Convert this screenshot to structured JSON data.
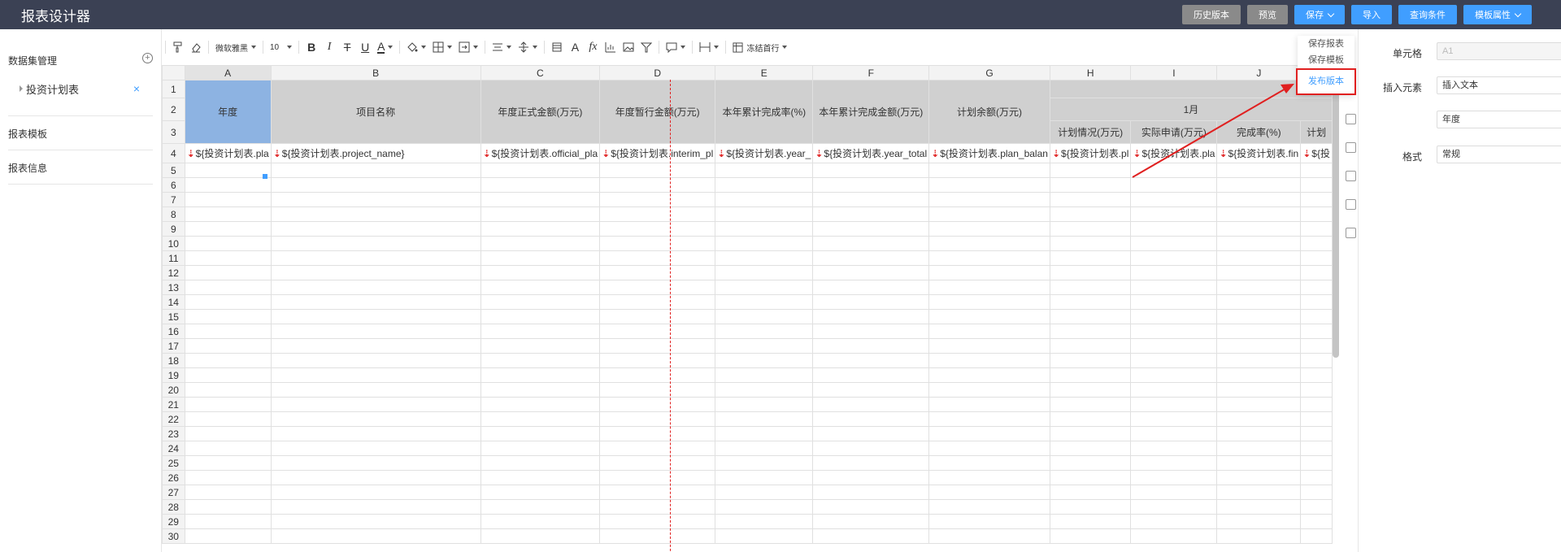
{
  "app": {
    "title": "报表设计器"
  },
  "top_buttons": {
    "history": "历史版本",
    "preview": "预览",
    "save": "保存",
    "import": "导入",
    "query": "查询条件",
    "template_props": "模板属性"
  },
  "save_menu": {
    "items": [
      "保存报表",
      "保存模板",
      "发布版本"
    ]
  },
  "sidebar": {
    "dataset": "数据集管理",
    "dataset_item": "投资计划表",
    "templates": "报表模板",
    "info": "报表信息"
  },
  "toolbar": {
    "font": "微软雅黑",
    "size": "10",
    "freeze": "冻结首行"
  },
  "columns": [
    "A",
    "B",
    "C",
    "D",
    "E",
    "F",
    "G",
    "H",
    "I",
    "J"
  ],
  "headers": {
    "A": "年度",
    "B": "项目名称",
    "C": "年度正式金额(万元)",
    "D": "年度暂行金额(万元)",
    "E": "本年累计完成率(%)",
    "F": "本年累计完成金额(万元)",
    "G": "计划余额(万元)",
    "month": "1月",
    "H": "计划情况(万元)",
    "I": "实际申请(万元)",
    "J": "完成率(%)",
    "K": "计划"
  },
  "fields": {
    "A": "${投资计划表.pla",
    "B": "${投资计划表.project_name}",
    "C": "${投资计划表.official_pla",
    "D": "${投资计划表.interim_pl",
    "E": "${投资计划表.year_",
    "F": "${投资计划表.year_total",
    "G": "${投资计划表.plan_balan",
    "H": "${投资计划表.pl",
    "I": "${投资计划表.pla",
    "J": "${投资计划表.fin",
    "K": "${投"
  },
  "row_numbers": [
    "1",
    "2",
    "3",
    "4",
    "5",
    "6",
    "7",
    "8",
    "9",
    "10",
    "11",
    "12",
    "13",
    "14",
    "15",
    "16",
    "17",
    "18",
    "19",
    "20",
    "21",
    "22",
    "23",
    "24",
    "25",
    "26",
    "27",
    "28",
    "29",
    "30"
  ],
  "properties": {
    "cell_label": "单元格",
    "cell_value": "A1",
    "insert_label": "插入元素",
    "insert_value": "插入文本",
    "text_value": "年度",
    "format_label": "格式",
    "format_value": "常规"
  },
  "colors": {
    "topbar": "#3b4154",
    "accent": "#409eff",
    "header_fill": "#d0d0d0",
    "selected_fill": "#8db3e2",
    "marker": "#e02020"
  }
}
